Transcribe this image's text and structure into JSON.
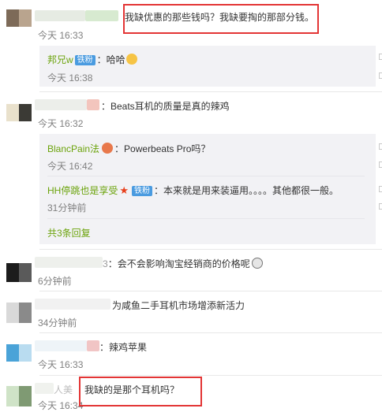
{
  "comments": [
    {
      "text": "我缺优惠的那些钱吗？我缺要掏的那部分钱。",
      "time": "今天 16:33"
    },
    {
      "text": "：Beats耳机的质量是真的辣鸡",
      "time": "今天 16:32"
    },
    {
      "text": "：会不会影响淘宝经销商的价格呢",
      "time": "6分钟前",
      "name_fragment": "3"
    },
    {
      "text": "为咸鱼二手耳机市场增添新活力",
      "time": "34分钟前"
    },
    {
      "text": "：辣鸡苹果",
      "time": "今天 16:33"
    },
    {
      "text": "我缺的是那个耳机吗？",
      "time": "今天 16:34",
      "name_fragment": "人美"
    }
  ],
  "replies": [
    {
      "user": "邦兄w",
      "badge": "铁粉",
      "text": "：哈哈",
      "time": "今天 16:38"
    },
    {
      "user": "BlancPain法",
      "text": "：Powerbeats Pro吗？",
      "time": "今天 16:42"
    },
    {
      "user": "HH停跳也是享受",
      "badge": "铁粉",
      "text": "：本来就是用来装逼用。。。。其他都很一般。",
      "time": "31分钟前"
    }
  ],
  "more_replies": "共3条回复",
  "colors": {
    "highlight": "#e33535",
    "username": "#6ba30b",
    "badge": "#4a9be0",
    "reply_bg": "#f2f2f5"
  }
}
